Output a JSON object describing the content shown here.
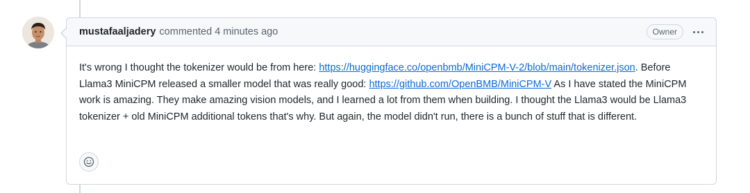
{
  "comment": {
    "author": "mustafaaljadery",
    "header_text": "commented 4 minutes ago",
    "badge": "Owner",
    "body": {
      "p1": "It's wrong I thought the tokenizer would be from here: ",
      "link1": "https://huggingface.co/openbmb/MiniCPM-V-2/blob/main/tokenizer.json",
      "p2": ". Before Llama3 MiniCPM released a smaller model that was really good: ",
      "link2": "https://github.com/OpenBMB/MiniCPM-V",
      "p3": " As I have stated the MiniCPM work is amazing. They make amazing vision models, and I learned a lot from them when building. I thought the Llama3 would be Llama3 tokenizer + old MiniCPM additional tokens that's why. But again, the model didn't run, there is a bunch of stuff that is different."
    }
  },
  "icons": {
    "menu": "kebab-horizontal-icon",
    "reaction": "smiley-icon"
  },
  "colors": {
    "link": "#0969da",
    "header_bg": "#f6f8fa",
    "border": "#d0d7de",
    "muted": "#59636e"
  }
}
